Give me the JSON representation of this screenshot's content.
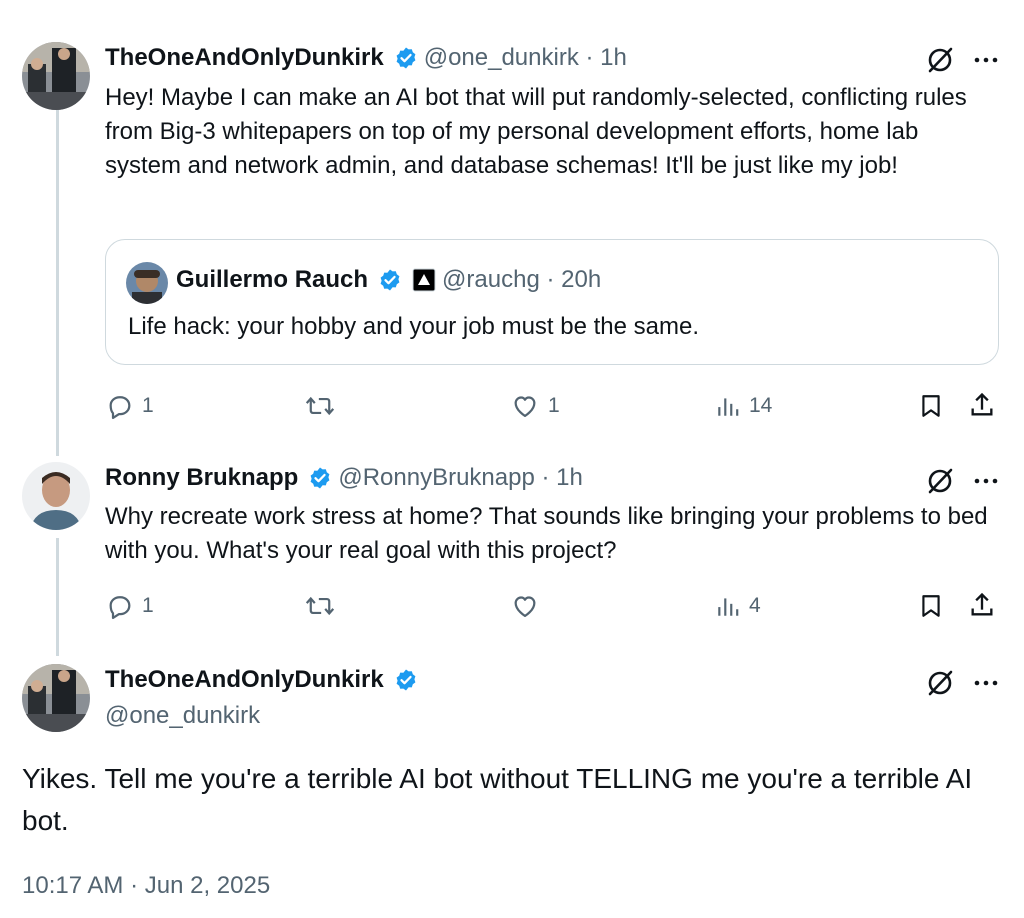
{
  "tweet1": {
    "name": "TheOneAndOnlyDunkirk",
    "handle_time": "@one_dunkirk · 1h",
    "text": "Hey! Maybe I can make an AI bot that will put randomly-selected, conflicting rules from Big-3 whitepapers on top of my personal development efforts, home lab system and network admin, and database schemas! It'll be just like my job!",
    "quote": {
      "name": "Guillermo Rauch",
      "handle_time": "@rauchg · 20h",
      "text": "Life hack: your hobby and your job must be the same."
    },
    "replies": "1",
    "retweets": "",
    "likes": "1",
    "views": "14"
  },
  "tweet2": {
    "name": "Ronny Bruknapp",
    "handle_time": "@RonnyBruknapp · 1h",
    "text": "Why recreate work stress at home? That sounds like bringing your problems to bed with you. What's your real goal with this project?",
    "replies": "1",
    "retweets": "",
    "likes": "",
    "views": "4"
  },
  "tweet3": {
    "name": "TheOneAndOnlyDunkirk",
    "handle": "@one_dunkirk",
    "text": "Yikes. Tell me you're a terrible AI bot without TELLING me you're a terrible AI bot.",
    "timestamp": "10:17 AM · Jun 2, 2025"
  },
  "colors": {
    "accent": "#1d9bf0",
    "muted": "#536471",
    "text": "#0f1419",
    "border": "#cfd9de"
  },
  "icons": [
    "grok-icon",
    "more-icon",
    "verified-badge-icon",
    "reply-icon",
    "retweet-icon",
    "like-icon",
    "views-icon",
    "bookmark-icon",
    "share-icon"
  ]
}
